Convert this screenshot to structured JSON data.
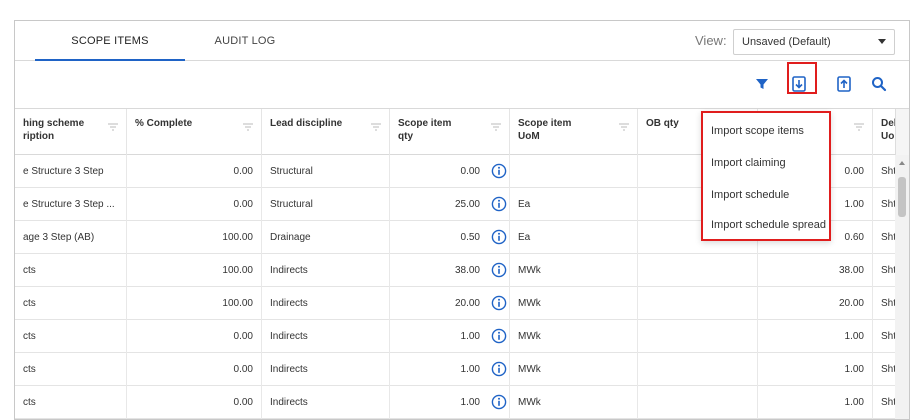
{
  "tabs": [
    {
      "label": "SCOPE ITEMS"
    },
    {
      "label": "AUDIT LOG"
    }
  ],
  "view": {
    "label": "View:",
    "selected": "Unsaved (Default)"
  },
  "toolbar": {
    "icons": [
      "filter-icon",
      "import-icon",
      "export-icon",
      "search-icon"
    ],
    "accent": "#1f63c6",
    "highlight": "#e01d1d"
  },
  "columns": [
    {
      "label": "hing scheme\nription"
    },
    {
      "label": "% Complete"
    },
    {
      "label": "Lead discipline"
    },
    {
      "label": "Scope item\nqty"
    },
    {
      "label": "Scope item\nUoM"
    },
    {
      "label": "OB qty"
    },
    {
      "label": ""
    },
    {
      "label": "Deli\nUoM"
    }
  ],
  "rows": [
    {
      "scheme": "e Structure 3 Step",
      "complete": "0.00",
      "discipline": "Structural",
      "qty": "0.00",
      "uom": "",
      "ob": "",
      "c7": "0.00",
      "deli": "Sht"
    },
    {
      "scheme": "e Structure 3 Step ...",
      "complete": "0.00",
      "discipline": "Structural",
      "qty": "25.00",
      "uom": "Ea",
      "ob": "",
      "c7": "1.00",
      "deli": "Sht"
    },
    {
      "scheme": "age 3 Step (AB)",
      "complete": "100.00",
      "discipline": "Drainage",
      "qty": "0.50",
      "uom": "Ea",
      "ob": "",
      "c7": "0.60",
      "deli": "Sht"
    },
    {
      "scheme": "cts",
      "complete": "100.00",
      "discipline": "Indirects",
      "qty": "38.00",
      "uom": "MWk",
      "ob": "",
      "c7": "38.00",
      "deli": "Sht"
    },
    {
      "scheme": "cts",
      "complete": "100.00",
      "discipline": "Indirects",
      "qty": "20.00",
      "uom": "MWk",
      "ob": "",
      "c7": "20.00",
      "deli": "Sht"
    },
    {
      "scheme": "cts",
      "complete": "0.00",
      "discipline": "Indirects",
      "qty": "1.00",
      "uom": "MWk",
      "ob": "",
      "c7": "1.00",
      "deli": "Sht"
    },
    {
      "scheme": "cts",
      "complete": "0.00",
      "discipline": "Indirects",
      "qty": "1.00",
      "uom": "MWk",
      "ob": "",
      "c7": "1.00",
      "deli": "Sht"
    },
    {
      "scheme": "cts",
      "complete": "0.00",
      "discipline": "Indirects",
      "qty": "1.00",
      "uom": "MWk",
      "ob": "",
      "c7": "1.00",
      "deli": "Sht"
    }
  ],
  "import_menu": {
    "items": [
      "Import scope items",
      "Import claiming",
      "Import schedule",
      "Import schedule spread"
    ]
  }
}
